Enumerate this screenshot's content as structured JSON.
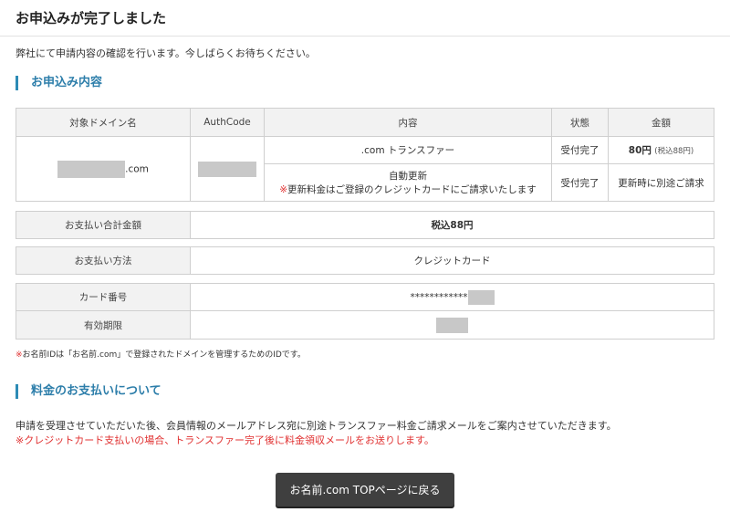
{
  "page": {
    "title": "お申込みが完了しました",
    "intro": "弊社にて申請内容の確認を行います。今しばらくお待ちください。"
  },
  "order": {
    "heading": "お申込み内容",
    "headers": [
      "対象ドメイン名",
      "AuthCode",
      "内容",
      "状態",
      "金額"
    ],
    "domain_suffix": ".com",
    "row1": {
      "content": ".com トランスファー",
      "status": "受付完了",
      "price": "80円",
      "price_note": "(税込88円)"
    },
    "row2": {
      "content": "自動更新",
      "note_mark": "※",
      "note": "更新料金はご登録のクレジットカードにご請求いたします",
      "status": "受付完了",
      "price": "更新時に別途ご請求"
    }
  },
  "payment": {
    "total_label": "お支払い合計金額",
    "total_value": "税込88円",
    "method_label": "お支払い方法",
    "method_value": "クレジットカード",
    "card_label": "カード番号",
    "card_value": "************",
    "expiry_label": "有効期限"
  },
  "footnote": {
    "mark": "※",
    "text": "お名前IDは「お名前.com」で登録されたドメインを管理するためのIDです。"
  },
  "billing": {
    "heading": "料金のお支払いについて",
    "line1": "申請を受理させていただいた後、会員情報のメールアドレス宛に別途トランスファー料金ご請求メールをご案内させていただきます。",
    "line2_mark": "※",
    "line2": "クレジットカード支払いの場合、トランスファー完了後に料金領収メールをお送りします。"
  },
  "actions": {
    "top_button": "お名前.com TOPページに戻る"
  }
}
